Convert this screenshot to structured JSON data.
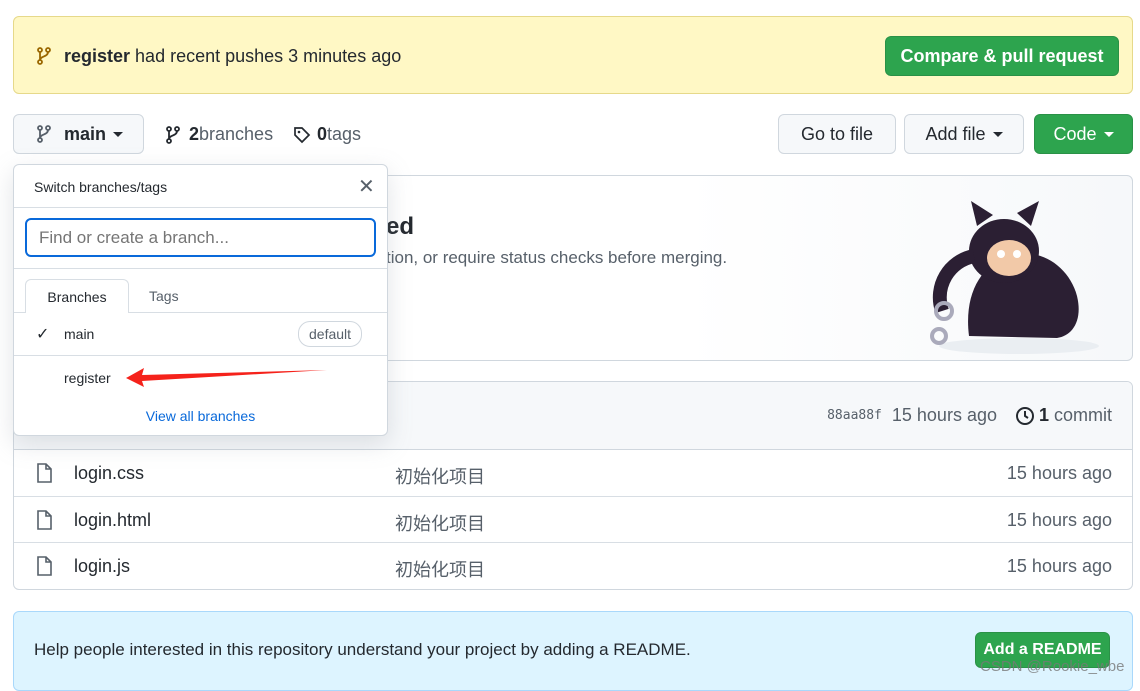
{
  "banner": {
    "branch": "register",
    "text": " had recent pushes 3 minutes ago",
    "button": "Compare & pull request"
  },
  "toolbar": {
    "branch": "main",
    "branches_count": "2",
    "branches_label": " branches",
    "tags_count": "0",
    "tags_label": " tags",
    "go_to_file": "Go to file",
    "add_file": "Add file",
    "code": "Code"
  },
  "protect": {
    "title_visible": "ed",
    "desc_visible": "tion, or require status checks before merging."
  },
  "dropdown": {
    "title": "Switch branches/tags",
    "placeholder": "Find or create a branch...",
    "tabs": [
      "Branches",
      "Tags"
    ],
    "branches": [
      {
        "name": "main",
        "badge": "default",
        "selected": true
      },
      {
        "name": "register"
      }
    ],
    "view_all": "View all branches"
  },
  "commit": {
    "sha": "88aa88f",
    "time": "15 hours ago",
    "count": "1",
    "count_label": " commit"
  },
  "files": [
    {
      "name": "login.css",
      "message": "初始化项目",
      "time": "15 hours ago"
    },
    {
      "name": "login.html",
      "message": "初始化项目",
      "time": "15 hours ago"
    },
    {
      "name": "login.js",
      "message": "初始化项目",
      "time": "15 hours ago"
    }
  ],
  "readme": {
    "text": "Help people interested in this repository understand your project by adding a README.",
    "button": "Add a README"
  },
  "watermark": "CSDN @Rookie_wbe",
  "colors": {
    "green": "#2da44e",
    "banner": "#fff8c5",
    "accent": "#0969da",
    "arrow": "#f5221b"
  }
}
